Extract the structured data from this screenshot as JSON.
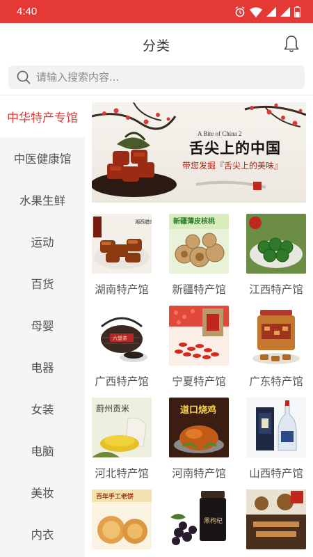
{
  "status": {
    "time": "4:40"
  },
  "header": {
    "title": "分类"
  },
  "search": {
    "placeholder": "请输入搜索内容..."
  },
  "sidebar": {
    "items": [
      {
        "label": "中华特产专馆",
        "active": true
      },
      {
        "label": "中医健康馆"
      },
      {
        "label": "水果生鲜"
      },
      {
        "label": "运动"
      },
      {
        "label": "百货"
      },
      {
        "label": "母婴"
      },
      {
        "label": "电器"
      },
      {
        "label": "女装"
      },
      {
        "label": "电脑"
      },
      {
        "label": "美妆"
      },
      {
        "label": "内衣"
      }
    ]
  },
  "banner": {
    "line1": "A Bite of China 2",
    "line2": "舌尖上的中国",
    "line3": "带您发掘『舌尖上的美味』"
  },
  "grid": {
    "items": [
      {
        "label": "湖南特产馆",
        "img_text": "湘西腊肉"
      },
      {
        "label": "新疆特产馆",
        "img_text": "新疆薄皮核桃"
      },
      {
        "label": "江西特产馆",
        "img_text": ""
      },
      {
        "label": "广西特产馆",
        "img_text": "六堡茶"
      },
      {
        "label": "宁夏特产馆",
        "img_text": ""
      },
      {
        "label": "广东特产馆",
        "img_text": ""
      },
      {
        "label": "河北特产馆",
        "img_text": "蔚州贡米"
      },
      {
        "label": "河南特产馆",
        "img_text": "道口烧鸡"
      },
      {
        "label": "山西特产馆",
        "img_text": ""
      },
      {
        "label": "",
        "img_text": "百年手工老饼"
      },
      {
        "label": "",
        "img_text": "黑枸杞"
      },
      {
        "label": "",
        "img_text": ""
      }
    ]
  },
  "colors": {
    "accent": "#e53935",
    "sidebar_bg": "#f5f5f5"
  }
}
